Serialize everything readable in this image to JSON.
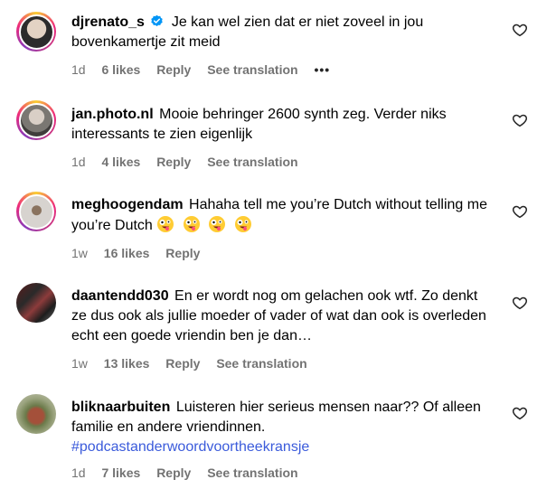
{
  "comments": [
    {
      "user": "djrenato_s",
      "text": "Je kan wel zien dat er niet zoveel in jou bovenkamertje zit meid",
      "time": "1d",
      "likes": "6 likes",
      "reply": "Reply",
      "translate": "See translation",
      "more": "•••"
    },
    {
      "user": "jan.photo.nl",
      "text": "Mooie behringer 2600 synth zeg. Verder niks interessants te zien eigenlijk",
      "time": "1d",
      "likes": "4 likes",
      "reply": "Reply",
      "translate": "See translation"
    },
    {
      "user": "meghoogendam",
      "text": "Hahaha tell me you’re Dutch without telling me you’re Dutch",
      "time": "1w",
      "likes": "16 likes",
      "reply": "Reply"
    },
    {
      "user": "daantendd030",
      "text": "En er wordt nog om gelachen ook wtf. Zo denkt ze dus ook als jullie moeder of vader of wat dan ook is overleden echt een goede vriendin ben je dan…",
      "time": "1w",
      "likes": "13 likes",
      "reply": "Reply",
      "translate": "See translation"
    },
    {
      "user": "bliknaarbuiten",
      "text": "Luisteren hier serieus mensen naar?? Of alleen familie en andere vriendinnen.",
      "hashtag": "#podcastanderwoordvoortheekransje",
      "time": "1d",
      "likes": "7 likes",
      "reply": "Reply",
      "translate": "See translation"
    }
  ],
  "icons": {
    "heart": "heart-outline-icon",
    "verified": "verified-badge-icon",
    "emoji": "zany-face-emoji"
  },
  "colors": {
    "meta": "#737373",
    "hashtag": "#3b5bdb",
    "verified": "#0095f6"
  }
}
